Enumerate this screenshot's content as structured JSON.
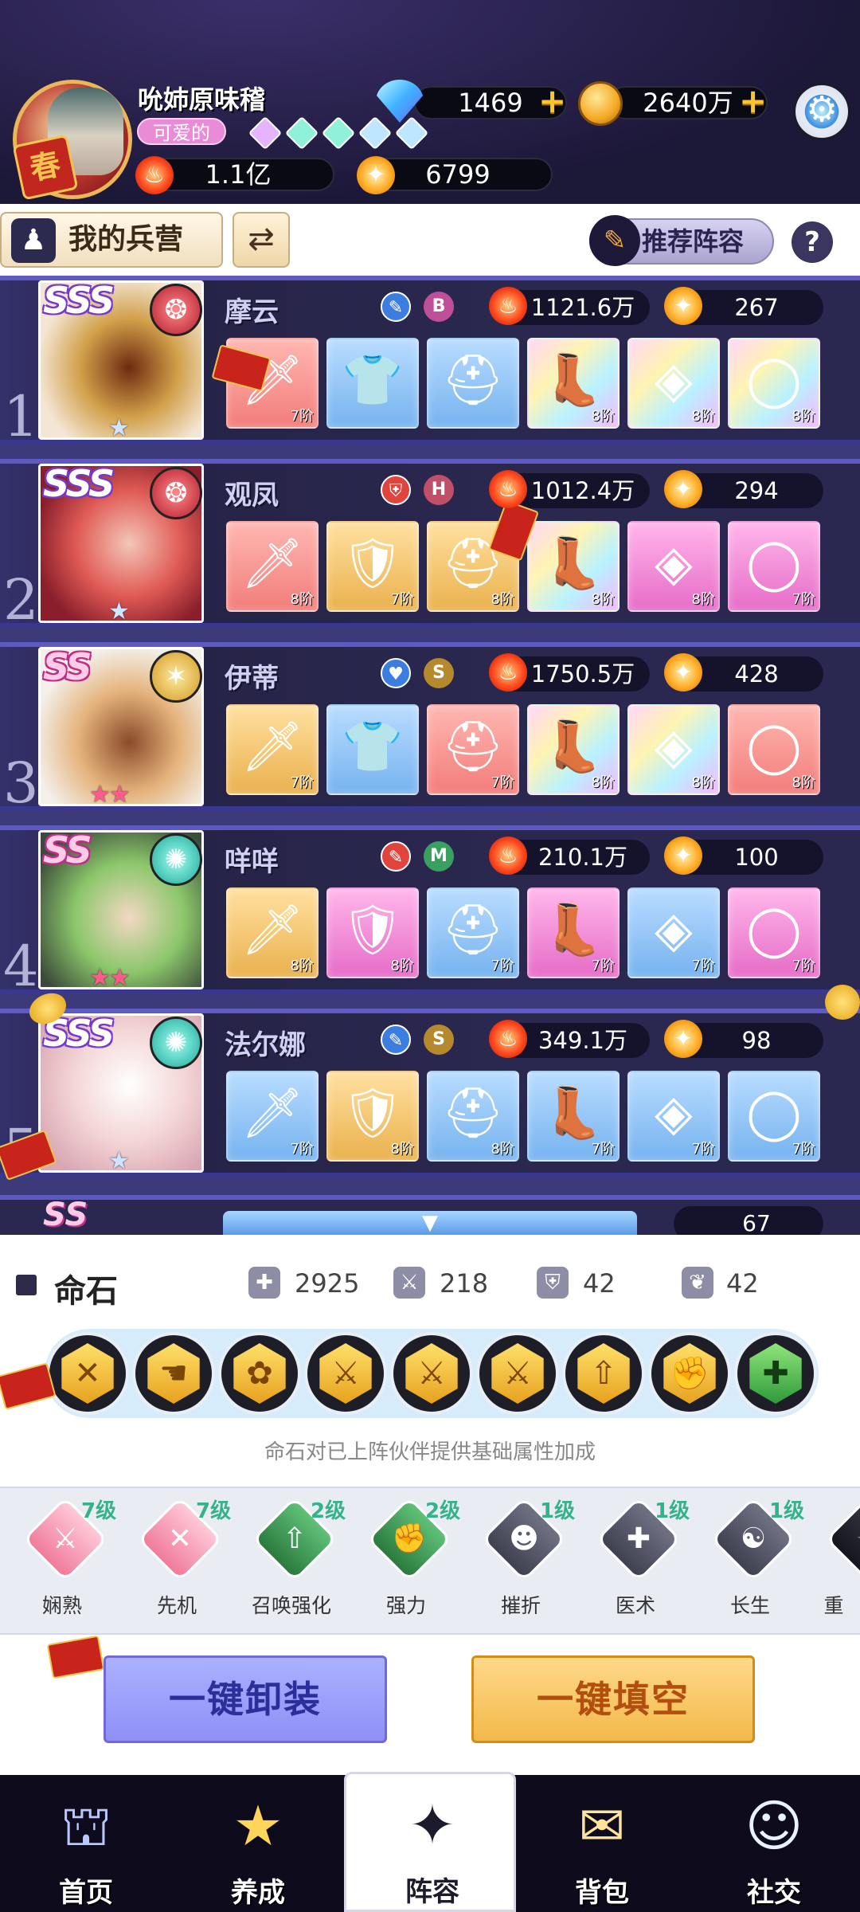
{
  "player": {
    "name": "吮姉原味稽",
    "title_tag": "可爱的",
    "power": "1.1亿",
    "level_score": "6799"
  },
  "currency": {
    "gems": "1469",
    "coins": "2640万"
  },
  "header": {
    "barracks_label": "我的兵营",
    "recommend_label": "推荐阵容",
    "help_label": "?"
  },
  "heroes": [
    {
      "rank": "1",
      "rarity": "SSS",
      "name": "摩云",
      "grade": "B",
      "power": "1121.6万",
      "level": "267",
      "equip_tiers": [
        "7阶",
        "",
        "",
        "8阶",
        "8阶",
        "8阶"
      ]
    },
    {
      "rank": "2",
      "rarity": "SSS",
      "name": "观凤",
      "grade": "H",
      "power": "1012.4万",
      "level": "294",
      "equip_tiers": [
        "8阶",
        "7阶",
        "8阶",
        "8阶",
        "8阶",
        "7阶"
      ]
    },
    {
      "rank": "3",
      "rarity": "SS",
      "name": "伊蒂",
      "grade": "S",
      "power": "1750.5万",
      "level": "428",
      "equip_tiers": [
        "7阶",
        "",
        "7阶",
        "8阶",
        "8阶",
        "8阶"
      ]
    },
    {
      "rank": "4",
      "rarity": "SS",
      "name": "咩咩",
      "grade": "M",
      "power": "210.1万",
      "level": "100",
      "equip_tiers": [
        "8阶",
        "8阶",
        "7阶",
        "7阶",
        "7阶",
        "7阶"
      ]
    },
    {
      "rank": "5",
      "rarity": "SSS",
      "name": "法尔娜",
      "grade": "S",
      "power": "349.1万",
      "level": "98",
      "equip_tiers": [
        "7阶",
        "8阶",
        "8阶",
        "7阶",
        "7阶",
        "7阶"
      ]
    }
  ],
  "partial_row": {
    "rarity": "SS",
    "level": "67"
  },
  "fate_stone": {
    "title": "命石",
    "hp": "2925",
    "attack": "218",
    "defense": "42",
    "resist": "42",
    "description": "命石对已上阵伙伴提供基础属性加成",
    "stones": [
      "sword-cross",
      "hand",
      "paw",
      "sword",
      "sword",
      "sword",
      "arrow-up",
      "fist",
      "plus-figure"
    ]
  },
  "talents": [
    {
      "name": "娴熟",
      "level": "7级",
      "style": "pink"
    },
    {
      "name": "先机",
      "level": "7级",
      "style": "pink"
    },
    {
      "name": "召唤强化",
      "level": "2级",
      "style": "green"
    },
    {
      "name": "强力",
      "level": "2级",
      "style": "green"
    },
    {
      "name": "摧折",
      "level": "1级",
      "style": "grey"
    },
    {
      "name": "医术",
      "level": "1级",
      "style": "grey"
    },
    {
      "name": "长生",
      "level": "1级",
      "style": "grey"
    },
    {
      "name": "重",
      "level": "",
      "style": "dark"
    }
  ],
  "actions": {
    "unequip_label": "一键卸装",
    "fill_label": "一键填空"
  },
  "nav": [
    {
      "label": "首页"
    },
    {
      "label": "养成"
    },
    {
      "label": "阵容"
    },
    {
      "label": "背包"
    },
    {
      "label": "社交"
    }
  ]
}
